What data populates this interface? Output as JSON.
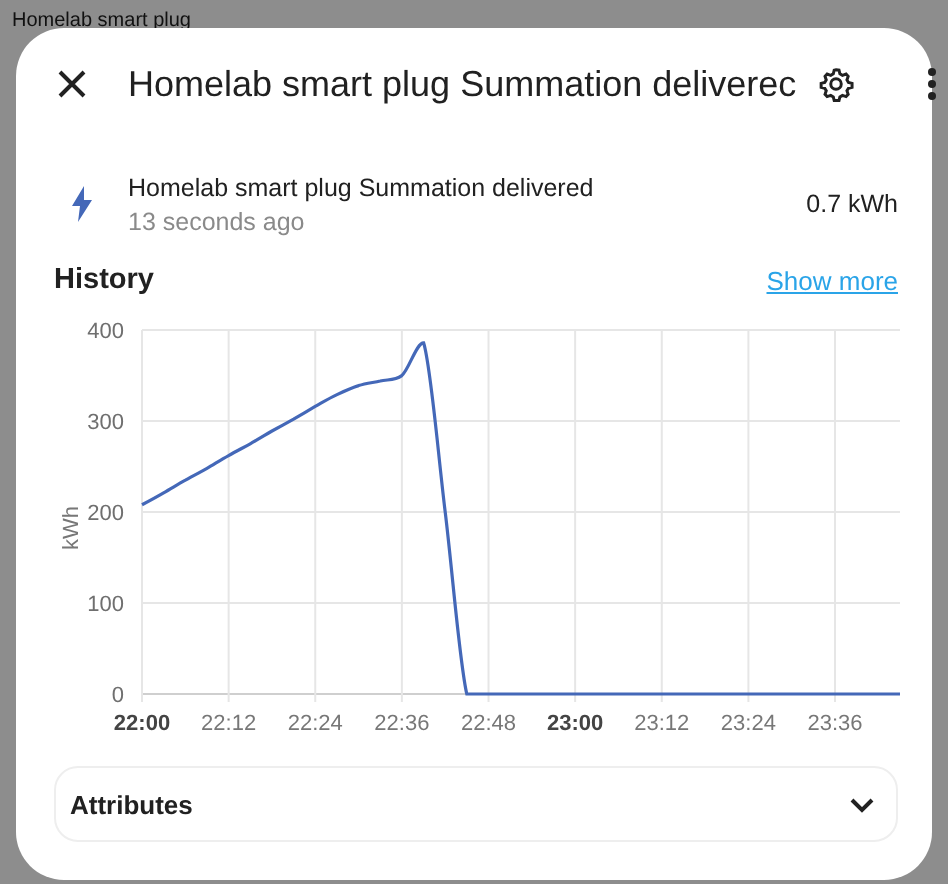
{
  "background_page": {
    "title": "Homelab smart plug"
  },
  "dialog": {
    "title": "Homelab smart plug Summation deliverec",
    "entity": {
      "name": "Homelab smart plug Summation delivered",
      "last_changed": "13 seconds ago",
      "state": "0.7 kWh"
    },
    "history": {
      "title": "History",
      "link": "Show more",
      "chart_data": {
        "type": "line",
        "grid": true,
        "ylabel": "kWh",
        "ylim": [
          0,
          400
        ],
        "yticks": [
          0,
          100,
          200,
          300,
          400
        ],
        "categories": [
          "22:00",
          null,
          null,
          null,
          "22:12",
          null,
          null,
          null,
          "22:24",
          null,
          null,
          null,
          "22:36",
          null,
          null,
          null,
          "22:48",
          null,
          null,
          null,
          "23:00",
          null,
          null,
          null,
          "23:12",
          null,
          null,
          null,
          "23:24",
          null,
          null,
          null,
          "23:36",
          null,
          null,
          null
        ],
        "series": [
          {
            "color": "#4468b8",
            "values": [
              208,
              221,
              235,
              248,
              262,
              275,
              289,
              302,
              316,
              329,
              339,
              344,
              350,
              386,
              200,
              0,
              0,
              0,
              0,
              0,
              0,
              0,
              0,
              0,
              0,
              0,
              0,
              0,
              0,
              0,
              0,
              0,
              0,
              0,
              0,
              0
            ]
          }
        ]
      }
    },
    "attributes": {
      "title": "Attributes",
      "expanded": false
    }
  }
}
